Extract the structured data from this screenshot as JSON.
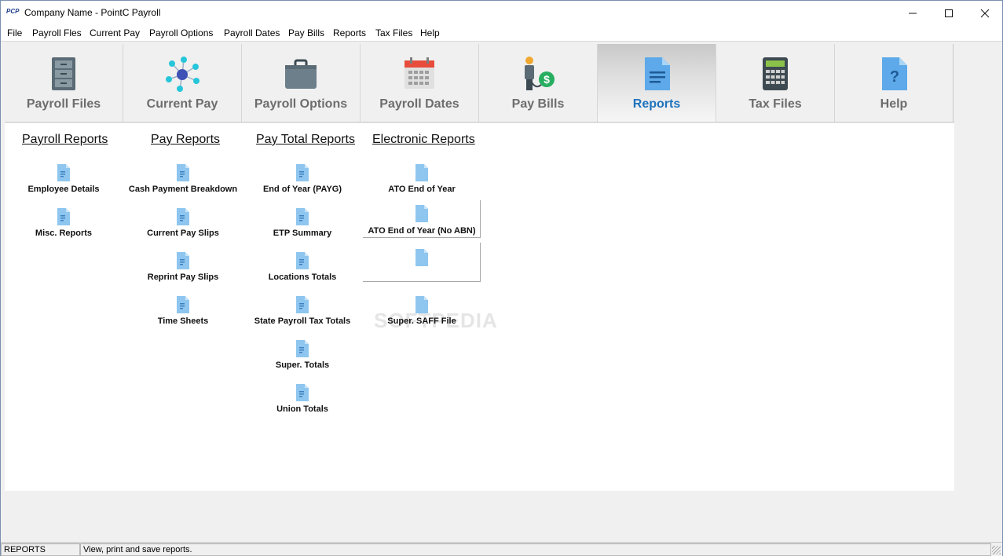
{
  "window": {
    "logo": "PCP",
    "title": "Company Name - PointC Payroll",
    "minimize": "—",
    "maximize": "☐",
    "close": "✕"
  },
  "menu": [
    "File",
    "Payroll Fles",
    "Current Pay",
    "Payroll Options",
    "Payroll Dates",
    "Pay Bills",
    "Reports",
    "Tax Files",
    "Help"
  ],
  "toolbar": {
    "active": "Reports",
    "tabs": [
      {
        "label": "Payroll Files",
        "icon": "filing-cabinet-icon"
      },
      {
        "label": "Current Pay",
        "icon": "network-nodes-icon"
      },
      {
        "label": "Payroll Options",
        "icon": "briefcase-icon"
      },
      {
        "label": "Payroll Dates",
        "icon": "calendar-icon"
      },
      {
        "label": "Pay Bills",
        "icon": "person-dollar-icon"
      },
      {
        "label": "Reports",
        "icon": "document-icon"
      },
      {
        "label": "Tax Files",
        "icon": "calculator-icon"
      },
      {
        "label": "Help",
        "icon": "help-document-icon"
      }
    ]
  },
  "reports": {
    "payroll_reports": {
      "header": "Payroll Reports",
      "items": [
        "Employee Details",
        "Misc. Reports"
      ]
    },
    "pay_reports": {
      "header": "Pay Reports",
      "items": [
        "Cash Payment Breakdown",
        "Current Pay Slips",
        "Reprint Pay Slips",
        "Time Sheets"
      ]
    },
    "pay_total_reports": {
      "header": "Pay Total Reports",
      "items": [
        "End of Year (PAYG)",
        "ETP Summary",
        "Locations Totals",
        "State Payroll Tax Totals",
        "Super. Totals",
        "Union Totals"
      ]
    },
    "electronic_reports": {
      "header": "Electronic Reports",
      "items": [
        "ATO End of Year",
        "ATO End of Year (No ABN)",
        "",
        "Super. SAFF File"
      ]
    }
  },
  "watermark": "SOFTPEDIA",
  "statusbar": {
    "section": "REPORTS",
    "message": "View, print and save reports."
  },
  "colors": {
    "accent": "#1e73be",
    "doc_icon": "#8ec6ef",
    "inactive_label": "#6d6d6d"
  }
}
